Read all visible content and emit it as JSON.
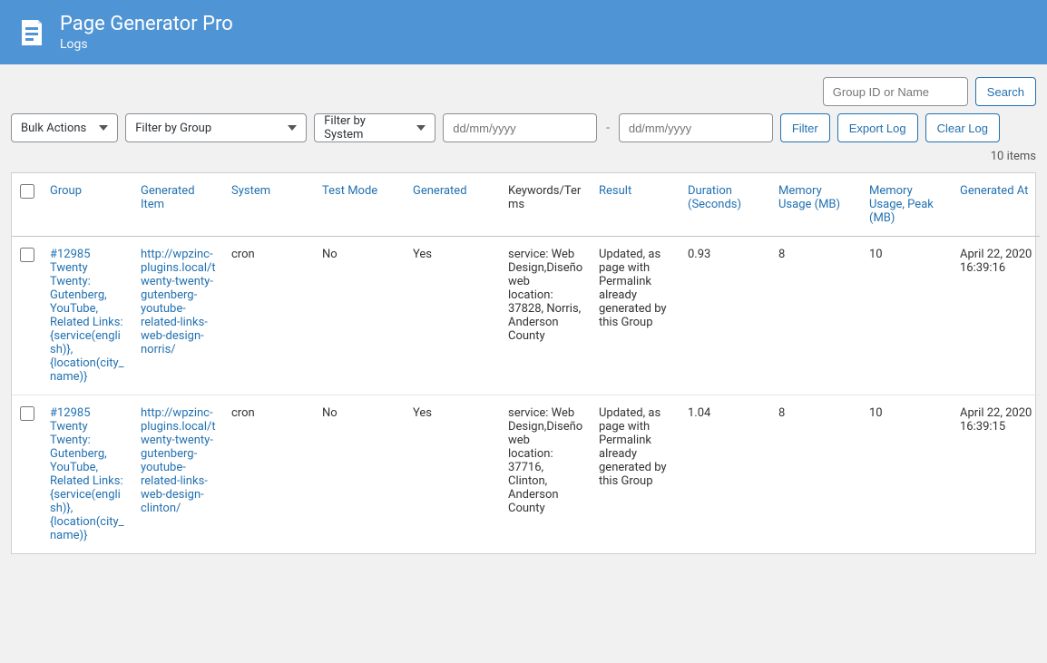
{
  "header": {
    "title": "Page Generator Pro",
    "subtitle": "Logs"
  },
  "search": {
    "placeholder": "Group ID or Name",
    "button": "Search"
  },
  "toolbar": {
    "bulk_actions": "Bulk Actions",
    "filter_group": "Filter by Group",
    "filter_system": "Filter by System",
    "date_placeholder": "dd/mm/yyyy",
    "range_sep": "-",
    "filter_btn": "Filter",
    "export_btn": "Export Log",
    "clear_btn": "Clear Log",
    "items_count": "10 items"
  },
  "columns": {
    "group": "Group",
    "generated_item": "Generated Item",
    "system": "System",
    "test_mode": "Test Mode",
    "generated": "Generated",
    "keywords": "Keywords/Terms",
    "result": "Result",
    "duration": "Duration (Seconds)",
    "memory": "Memory Usage (MB)",
    "memory_peak": "Memory Usage, Peak (MB)",
    "generated_at": "Generated At"
  },
  "rows": [
    {
      "group": "#12985 Twenty Twenty: Gutenberg, YouTube, Related Links: {service(english)}, {location(city_name)}",
      "generated_item": "http://wpzinc-plugins.local/twenty-twenty-gutenberg-youtube-related-links-web-design-norris/",
      "system": "cron",
      "test_mode": "No",
      "generated": "Yes",
      "keywords": "service: Web Design,Diseño web\nlocation: 37828, Norris, Anderson County",
      "result": "Updated, as page with Permalink already generated by this Group",
      "duration": "0.93",
      "memory": "8",
      "memory_peak": "10",
      "generated_at": "April 22, 2020 16:39:16"
    },
    {
      "group": "#12985 Twenty Twenty: Gutenberg, YouTube, Related Links: {service(english)}, {location(city_name)}",
      "generated_item": "http://wpzinc-plugins.local/twenty-twenty-gutenberg-youtube-related-links-web-design-clinton/",
      "system": "cron",
      "test_mode": "No",
      "generated": "Yes",
      "keywords": "service: Web Design,Diseño web\nlocation: 37716, Clinton, Anderson County",
      "result": "Updated, as page with Permalink already generated by this Group",
      "duration": "1.04",
      "memory": "8",
      "memory_peak": "10",
      "generated_at": "April 22, 2020 16:39:15"
    }
  ]
}
